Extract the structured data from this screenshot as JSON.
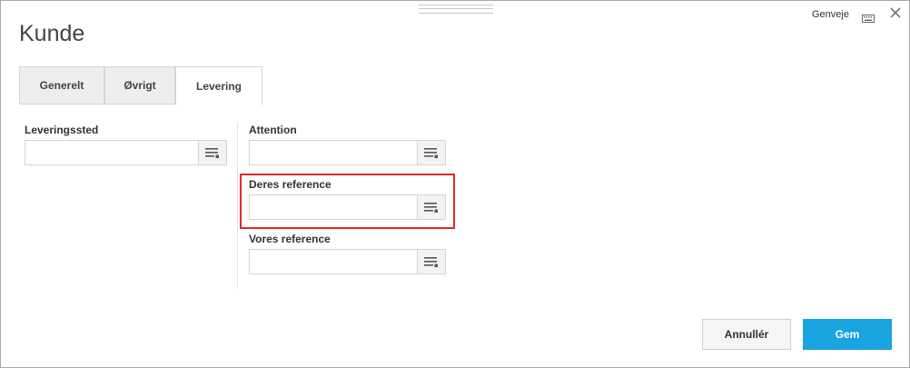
{
  "header": {
    "title": "Kunde",
    "shortcut_label": "Genveje",
    "keyboard_icon": "keyboard-icon",
    "close_icon": "close-icon"
  },
  "tabs": [
    {
      "label": "Generelt",
      "active": false
    },
    {
      "label": "Øvrigt",
      "active": false
    },
    {
      "label": "Levering",
      "active": true
    }
  ],
  "left_column": {
    "fields": [
      {
        "label": "Leveringssted",
        "value": "",
        "lookup_icon": "list-lookup-icon"
      }
    ]
  },
  "right_column": {
    "fields": [
      {
        "label": "Attention",
        "value": "",
        "lookup_icon": "list-lookup-icon"
      },
      {
        "label": "Deres reference",
        "value": "",
        "lookup_icon": "list-lookup-icon",
        "highlighted": true
      },
      {
        "label": "Vores reference",
        "value": "",
        "lookup_icon": "list-lookup-icon"
      }
    ]
  },
  "footer": {
    "cancel_label": "Annullér",
    "save_label": "Gem"
  },
  "colors": {
    "primary_button": "#1aa4e0",
    "highlight_border": "#e0292a"
  }
}
